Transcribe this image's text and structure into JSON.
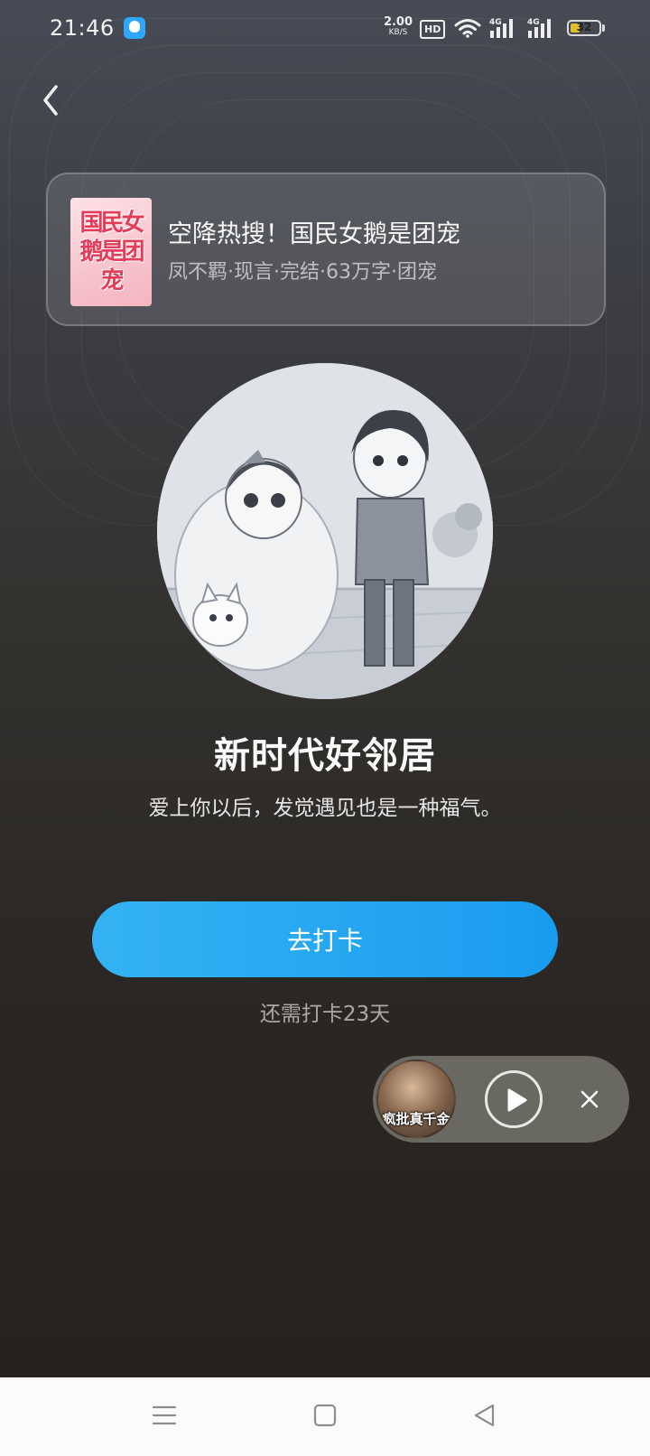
{
  "status_bar": {
    "time": "21:46",
    "net_speed_value": "2.00",
    "net_speed_unit": "KB/S",
    "hd_label": "HD",
    "signal_label_1": "4G",
    "signal_label_2": "4G",
    "battery_level": "32",
    "battery_fraction": 0.32,
    "battery_color": "#e2bd2c"
  },
  "header": {
    "back_icon": "chevron-left-icon"
  },
  "book": {
    "cover_title": "国民女鹅是团宠",
    "title": "空降热搜！国民女鹅是团宠",
    "meta": "凤不羁·现言·完结·63万字·团宠"
  },
  "achievement": {
    "title": "新时代好邻居",
    "description": "爱上你以后，发觉遇见也是一种福气。"
  },
  "actions": {
    "checkin_label": "去打卡",
    "remaining_text": "还需打卡23天",
    "accent_color": "#1a9cee"
  },
  "mini_player": {
    "cover_text": "疯批真千金",
    "play_icon": "play-icon",
    "close_icon": "close-icon"
  },
  "nav_bar": {
    "menu_icon": "menu-icon",
    "home_icon": "home-square-icon",
    "back_icon": "back-triangle-icon"
  }
}
